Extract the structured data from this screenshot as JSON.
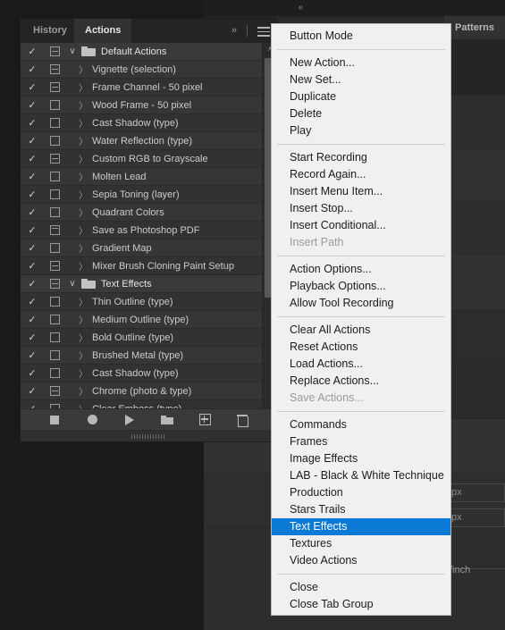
{
  "app": {
    "background_color": "#1a1a1a",
    "panel_color": "#323232",
    "menu_bg_color": "#f0f0f0",
    "highlight_color": "#0a7ad6"
  },
  "workspace": {
    "collapse_icon": "«",
    "patterns_tab_label": "Patterns",
    "field_a_value": "px",
    "field_b_value": "px",
    "resolution_unit_label": "/inch"
  },
  "panel": {
    "tabs": [
      {
        "label": "History",
        "active": false
      },
      {
        "label": "Actions",
        "active": true
      }
    ],
    "overflow_icon": "»",
    "menu_icon": "hamburger-icon",
    "scrollbar": {
      "up_arrow": "∧",
      "down_arrow": "∨"
    },
    "rows": [
      {
        "label": "Default Actions",
        "checked": "✓",
        "dialog": "modal",
        "type": "set",
        "twisty": "∨"
      },
      {
        "label": "Vignette (selection)",
        "checked": "✓",
        "dialog": "modal",
        "type": "action",
        "twisty": "〉"
      },
      {
        "label": "Frame Channel - 50 pixel",
        "checked": "✓",
        "dialog": "modal",
        "type": "action",
        "twisty": "〉"
      },
      {
        "label": "Wood Frame - 50 pixel",
        "checked": "✓",
        "dialog": "empty",
        "type": "action",
        "twisty": "〉"
      },
      {
        "label": "Cast Shadow (type)",
        "checked": "✓",
        "dialog": "empty",
        "type": "action",
        "twisty": "〉"
      },
      {
        "label": "Water Reflection (type)",
        "checked": "✓",
        "dialog": "empty",
        "type": "action",
        "twisty": "〉"
      },
      {
        "label": "Custom RGB to Grayscale",
        "checked": "✓",
        "dialog": "modal",
        "type": "action",
        "twisty": "〉"
      },
      {
        "label": "Molten Lead",
        "checked": "✓",
        "dialog": "empty",
        "type": "action",
        "twisty": "〉"
      },
      {
        "label": "Sepia Toning (layer)",
        "checked": "✓",
        "dialog": "empty",
        "type": "action",
        "twisty": "〉"
      },
      {
        "label": "Quadrant Colors",
        "checked": "✓",
        "dialog": "empty",
        "type": "action",
        "twisty": "〉"
      },
      {
        "label": "Save as Photoshop PDF",
        "checked": "✓",
        "dialog": "partial",
        "type": "action",
        "twisty": "〉"
      },
      {
        "label": "Gradient Map",
        "checked": "✓",
        "dialog": "empty",
        "type": "action",
        "twisty": "〉"
      },
      {
        "label": "Mixer Brush Cloning Paint Setup",
        "checked": "✓",
        "dialog": "modal",
        "type": "action",
        "twisty": "〉"
      },
      {
        "label": "Text Effects",
        "checked": "✓",
        "dialog": "modal",
        "type": "set",
        "twisty": "∨"
      },
      {
        "label": "Thin Outline (type)",
        "checked": "✓",
        "dialog": "empty",
        "type": "action",
        "twisty": "〉"
      },
      {
        "label": "Medium Outline (type)",
        "checked": "✓",
        "dialog": "empty",
        "type": "action",
        "twisty": "〉"
      },
      {
        "label": "Bold Outline (type)",
        "checked": "✓",
        "dialog": "empty",
        "type": "action",
        "twisty": "〉"
      },
      {
        "label": "Brushed Metal (type)",
        "checked": "✓",
        "dialog": "empty",
        "type": "action",
        "twisty": "〉"
      },
      {
        "label": "Cast Shadow (type)",
        "checked": "✓",
        "dialog": "empty",
        "type": "action",
        "twisty": "〉"
      },
      {
        "label": "Chrome (photo & type)",
        "checked": "✓",
        "dialog": "modal",
        "type": "action",
        "twisty": "〉"
      },
      {
        "label": "Clear Emboss (type)",
        "checked": "✓",
        "dialog": "empty",
        "type": "action",
        "twisty": "〉"
      }
    ],
    "buttons": [
      {
        "name": "stop-button",
        "icon": "stop-icon"
      },
      {
        "name": "record-button",
        "icon": "record-icon"
      },
      {
        "name": "play-button",
        "icon": "play-icon"
      },
      {
        "name": "new-set-button",
        "icon": "folder-icon"
      },
      {
        "name": "new-action-button",
        "icon": "new-icon"
      },
      {
        "name": "delete-button",
        "icon": "trash-icon"
      }
    ]
  },
  "context_menu": {
    "items": [
      {
        "label": "Button Mode",
        "state": "normal"
      },
      {
        "type": "separator"
      },
      {
        "label": "New Action...",
        "state": "normal"
      },
      {
        "label": "New Set...",
        "state": "normal"
      },
      {
        "label": "Duplicate",
        "state": "normal"
      },
      {
        "label": "Delete",
        "state": "normal"
      },
      {
        "label": "Play",
        "state": "normal"
      },
      {
        "type": "separator"
      },
      {
        "label": "Start Recording",
        "state": "normal"
      },
      {
        "label": "Record Again...",
        "state": "normal"
      },
      {
        "label": "Insert Menu Item...",
        "state": "normal"
      },
      {
        "label": "Insert Stop...",
        "state": "normal"
      },
      {
        "label": "Insert Conditional...",
        "state": "normal"
      },
      {
        "label": "Insert Path",
        "state": "disabled"
      },
      {
        "type": "separator"
      },
      {
        "label": "Action Options...",
        "state": "normal"
      },
      {
        "label": "Playback Options...",
        "state": "normal"
      },
      {
        "label": "Allow Tool Recording",
        "state": "normal"
      },
      {
        "type": "separator"
      },
      {
        "label": "Clear All Actions",
        "state": "normal"
      },
      {
        "label": "Reset Actions",
        "state": "normal"
      },
      {
        "label": "Load Actions...",
        "state": "normal"
      },
      {
        "label": "Replace Actions...",
        "state": "normal"
      },
      {
        "label": "Save Actions...",
        "state": "disabled"
      },
      {
        "type": "separator"
      },
      {
        "label": "Commands",
        "state": "normal"
      },
      {
        "label": "Frames",
        "state": "normal"
      },
      {
        "label": "Image Effects",
        "state": "normal"
      },
      {
        "label": "LAB - Black & White Technique",
        "state": "normal"
      },
      {
        "label": "Production",
        "state": "normal"
      },
      {
        "label": "Stars Trails",
        "state": "normal"
      },
      {
        "label": "Text Effects",
        "state": "selected"
      },
      {
        "label": "Textures",
        "state": "normal"
      },
      {
        "label": "Video Actions",
        "state": "normal"
      },
      {
        "type": "separator"
      },
      {
        "label": "Close",
        "state": "normal"
      },
      {
        "label": "Close Tab Group",
        "state": "normal"
      }
    ]
  }
}
